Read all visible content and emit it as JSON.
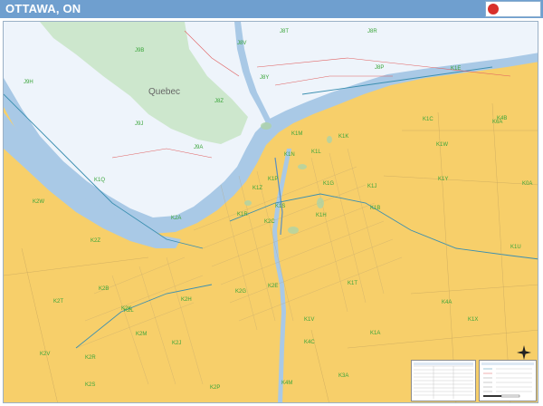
{
  "header": {
    "title": "OTTAWA, ON",
    "background": "#6f9fcf"
  },
  "map": {
    "place_labels": {
      "quebec": "Quebec"
    },
    "postal_codes": [
      "J9B",
      "J8V",
      "J8T",
      "J8R",
      "J9H",
      "J9J",
      "J8Z",
      "J8Y",
      "J9A",
      "J8P",
      "K1M",
      "K1K",
      "K1L",
      "K1N",
      "K1P",
      "K1R",
      "K1S",
      "K1G",
      "K1H",
      "K1J",
      "K2A",
      "K2B",
      "K2C",
      "K2E",
      "K2G",
      "K2H",
      "K2J",
      "K2K",
      "K2L",
      "K2M",
      "K2R",
      "K2S",
      "K2T",
      "K2V",
      "K2W",
      "K4A",
      "K4B",
      "K4C",
      "K1T",
      "K1V",
      "K1W",
      "K1X",
      "K1Y",
      "K1Z",
      "K0A",
      "K1B",
      "K4M",
      "K1C",
      "K1E",
      "K2P",
      "K1A",
      "K6A",
      "K3A",
      "K2Z",
      "K1Q",
      "K1U"
    ],
    "colors": {
      "land_ontario": "#f7cf6a",
      "land_quebec": "#eef4fb",
      "water": "#a9c9e6",
      "park": "#cde7cd",
      "postal_text": "#3aa53a",
      "boundary": "#e06060"
    },
    "compass": "north-arrow"
  }
}
